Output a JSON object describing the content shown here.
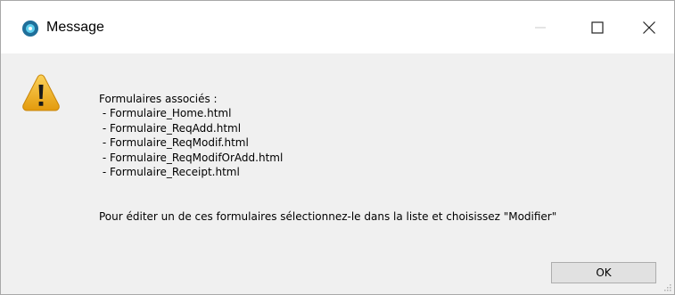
{
  "window": {
    "title": "Message",
    "controls": {
      "minimize_icon": "minimize-icon",
      "maximize_icon": "maximize-icon",
      "close_icon": "close-icon"
    }
  },
  "dialog": {
    "icon": "warning-icon",
    "heading": "Formulaires associés :",
    "items": [
      " - Formulaire_Home.html",
      " - Formulaire_ReqAdd.html",
      " - Formulaire_ReqModif.html",
      " - Formulaire_ReqModifOrAdd.html",
      " - Formulaire_Receipt.html"
    ],
    "footer": "Pour éditer un de ces formulaires sélectionnez-le dans la liste et choisissez \"Modifier\"",
    "ok_label": "OK"
  },
  "colors": {
    "titlebar": "#ffffff",
    "body": "#f0f0f0",
    "app_icon": "#1f6f9a",
    "warning": "#f2b319",
    "button_face": "#e1e1e1",
    "button_border": "#adadad"
  }
}
